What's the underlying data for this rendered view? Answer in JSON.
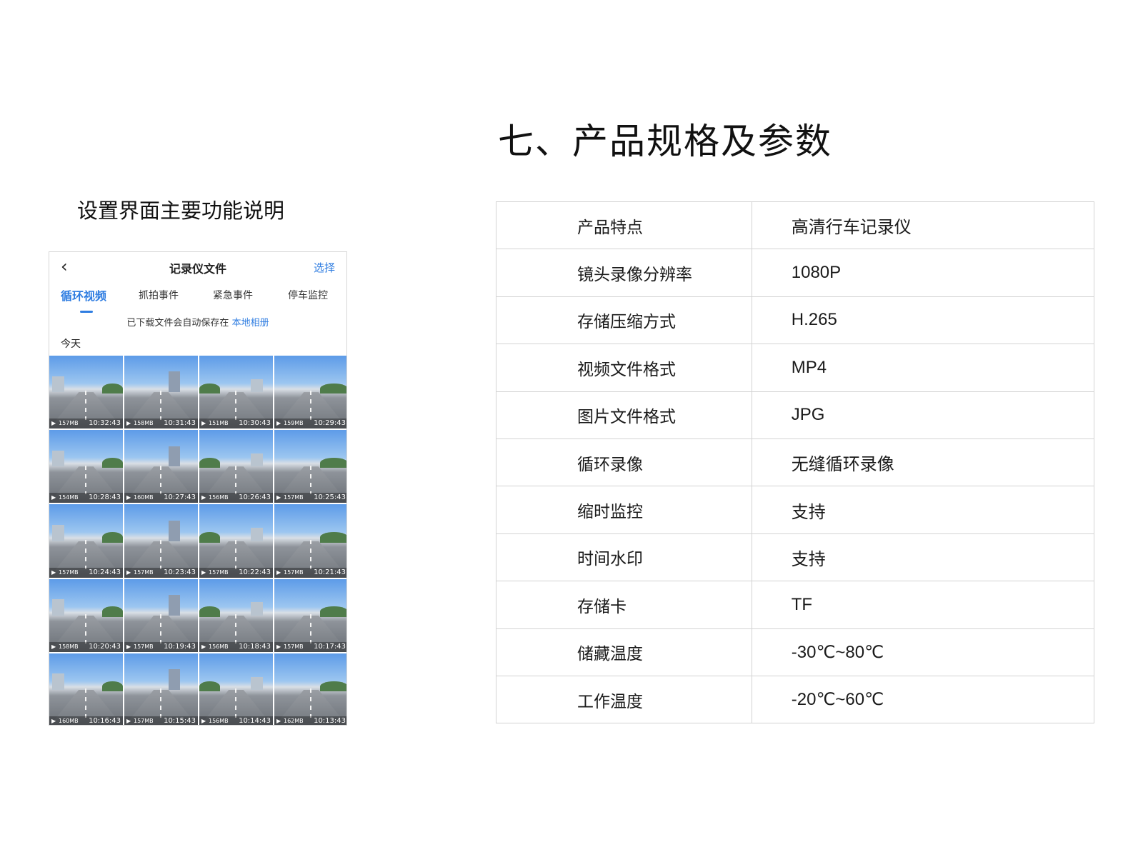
{
  "heading": "七、产品规格及参数",
  "subheading": "设置界面主要功能说明",
  "phone": {
    "back_icon": "‹",
    "title": "记录仪文件",
    "select_label": "选择",
    "tabs": [
      {
        "label": "循环视频",
        "active": true
      },
      {
        "label": "抓拍事件",
        "active": false
      },
      {
        "label": "紧急事件",
        "active": false
      },
      {
        "label": "停车监控",
        "active": false
      }
    ],
    "notice_text": "已下载文件会自动保存在 ",
    "notice_link": "本地相册",
    "section_label": "今天",
    "play_icon": "▶",
    "thumbnails": [
      {
        "size": "157MB",
        "time": "10:32:43"
      },
      {
        "size": "158MB",
        "time": "10:31:43"
      },
      {
        "size": "151MB",
        "time": "10:30:43"
      },
      {
        "size": "159MB",
        "time": "10:29:43"
      },
      {
        "size": "154MB",
        "time": "10:28:43"
      },
      {
        "size": "160MB",
        "time": "10:27:43"
      },
      {
        "size": "156MB",
        "time": "10:26:43"
      },
      {
        "size": "157MB",
        "time": "10:25:43"
      },
      {
        "size": "157MB",
        "time": "10:24:43"
      },
      {
        "size": "157MB",
        "time": "10:23:43"
      },
      {
        "size": "157MB",
        "time": "10:22:43"
      },
      {
        "size": "157MB",
        "time": "10:21:43"
      },
      {
        "size": "158MB",
        "time": "10:20:43"
      },
      {
        "size": "157MB",
        "time": "10:19:43"
      },
      {
        "size": "156MB",
        "time": "10:18:43"
      },
      {
        "size": "157MB",
        "time": "10:17:43"
      },
      {
        "size": "160MB",
        "time": "10:16:43"
      },
      {
        "size": "157MB",
        "time": "10:15:43"
      },
      {
        "size": "156MB",
        "time": "10:14:43"
      },
      {
        "size": "162MB",
        "time": "10:13:43"
      }
    ]
  },
  "spec_table": [
    {
      "key": "产品特点",
      "value": "高清行车记录仪"
    },
    {
      "key": "镜头录像分辨率",
      "value": "1080P"
    },
    {
      "key": "存储压缩方式",
      "value": "H.265"
    },
    {
      "key": "视频文件格式",
      "value": "MP4"
    },
    {
      "key": "图片文件格式",
      "value": "JPG"
    },
    {
      "key": "循环录像",
      "value": "无缝循环录像"
    },
    {
      "key": "缩时监控",
      "value": "支持"
    },
    {
      "key": "时间水印",
      "value": "支持"
    },
    {
      "key": "存储卡",
      "value": "TF"
    },
    {
      "key": "储藏温度",
      "value": "-30℃~80℃"
    },
    {
      "key": "工作温度",
      "value": "-20℃~60℃"
    }
  ],
  "colors": {
    "accent": "#2f7de1",
    "border": "#d3d3d3"
  }
}
